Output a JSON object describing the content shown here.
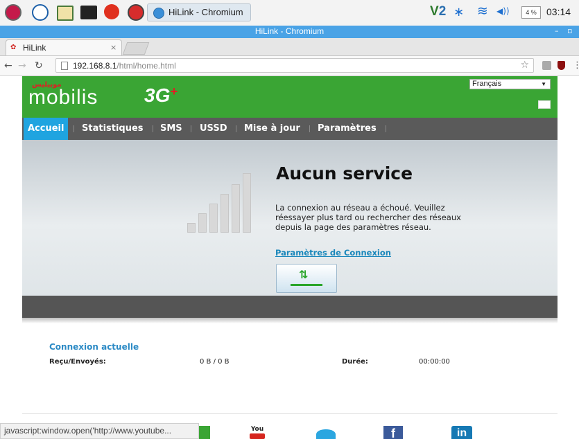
{
  "taskbar": {
    "active_app": "HiLink - Chromium",
    "battery": "4 %",
    "clock": "03:14",
    "icons": [
      "raspberry-icon",
      "globe-icon",
      "folder-icon",
      "terminal-icon",
      "burst-icon",
      "chromium-icon"
    ],
    "tray_icons": [
      "vnc-icon",
      "bluetooth-icon",
      "wifi-icon",
      "volume-icon"
    ]
  },
  "window": {
    "title": "HiLink - Chromium",
    "controls": [
      "–",
      "▫"
    ]
  },
  "browser": {
    "tab_label": "HiLink",
    "tab_close": "×",
    "url_host": "192.168.8.1",
    "url_path": "/html/home.html",
    "status_url": "javascript:window.open('http://www.youtube..."
  },
  "site": {
    "brand": "mobilis",
    "brand_ar": "موبيليس",
    "network_tag": "3G",
    "network_plus": "+",
    "language": "Français",
    "menu": [
      {
        "label": "Accueil",
        "active": true
      },
      {
        "label": "Statistiques",
        "active": false
      },
      {
        "label": "SMS",
        "active": false
      },
      {
        "label": "USSD",
        "active": false
      },
      {
        "label": "Mise à jour",
        "active": false
      },
      {
        "label": "Paramètres",
        "active": false
      }
    ],
    "signal_level": 0,
    "status_title": "Aucun service",
    "status_message": "La connexion au réseau a échoué. Veuillez réessayer plus tard ou rechercher des réseaux depuis la page des paramètres réseau.",
    "status_link": "Paramètres de Connexion",
    "connect_icon": "⇅",
    "connection": {
      "title": "Connexion actuelle",
      "recv_sent_label": "Reçu/Envoyés:",
      "recv_sent_value": "0 B / 0 B",
      "duration_label": "Durée:",
      "duration_value": "00:00:00"
    },
    "footer_social": [
      "youtube-icon",
      "twitter-icon",
      "facebook-icon",
      "linkedin-icon"
    ],
    "footer_social_labels": [
      "You",
      "f",
      "in"
    ]
  },
  "colors": {
    "brand_green": "#3aa534",
    "menu_bg": "#5a5a5a",
    "active_tab": "#1fa4e0",
    "link": "#1a87bb"
  }
}
